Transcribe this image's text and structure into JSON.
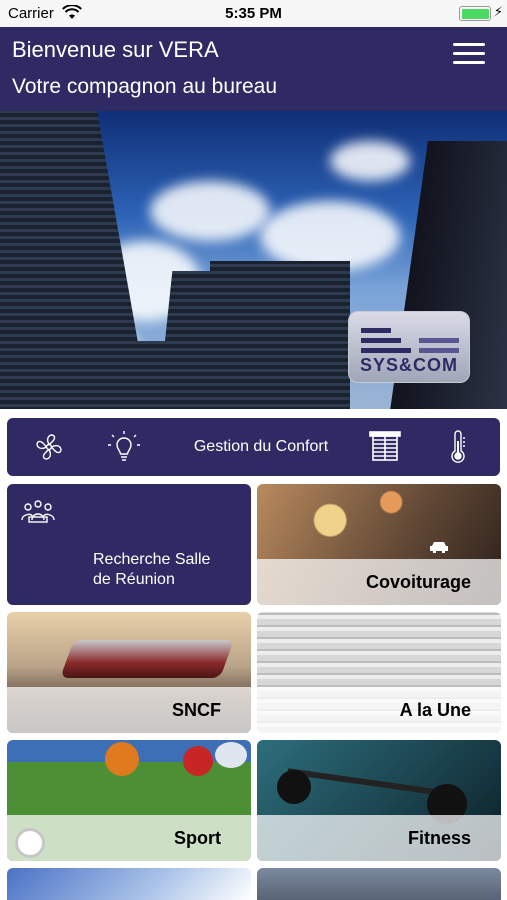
{
  "status_bar": {
    "carrier": "Carrier",
    "time": "5:35 PM"
  },
  "header": {
    "title": "Bienvenue sur VERA",
    "subtitle": "Votre compagnon au bureau"
  },
  "hero": {
    "logo_text": "SYS&COM"
  },
  "comfort": {
    "label": "Gestion du Confort",
    "icons": [
      "fan-icon",
      "lightbulb-icon",
      "blinds-icon",
      "thermometer-icon"
    ]
  },
  "tiles": [
    {
      "label": "Recherche Salle\nde Réunion",
      "icon": "meeting-icon"
    },
    {
      "label": "Covoiturage",
      "icon": "car-icon"
    },
    {
      "label": "SNCF"
    },
    {
      "label": "A la Une"
    },
    {
      "label": "Sport"
    },
    {
      "label": "Fitness"
    }
  ],
  "colors": {
    "brand": "#2f2a63",
    "battery": "#4cd964"
  }
}
